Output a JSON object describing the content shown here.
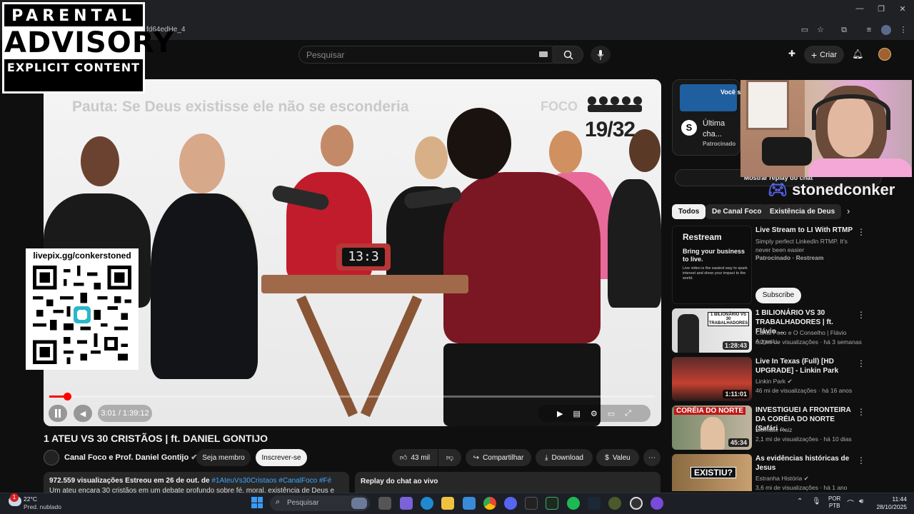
{
  "browser": {
    "url_fragment": "fd64edHe_4",
    "window_controls": [
      "—",
      "❐",
      "✕"
    ]
  },
  "youtube_header": {
    "search_placeholder": "Pesquisar",
    "create_label": "Criar"
  },
  "overlays": {
    "advisory": {
      "line1": "PARENTAL",
      "line2": "ADVISORY",
      "line3": "EXPLICIT CONTENT"
    },
    "donation_url": "livepix.gg/conkerstoned",
    "streamer_name": "stonedconker"
  },
  "video": {
    "banner_text": "Pauta: Se Deus existisse ele não se esconderia",
    "logo_text": "FOCO",
    "counter": "19/32",
    "clock_value": "13:3",
    "time_display": "3:01 / 1:39:12",
    "progress_fraction": 0.03
  },
  "video_info": {
    "title": "1 ATEU VS 30 CRISTÃOS | ft. DANIEL GONTIJO",
    "channel": "Canal Foco e Prof. Daniel Gontijo",
    "join_label": "Seja membro",
    "subscribe_label": "Inscrever-se",
    "likes": "43 mil",
    "share_label": "Compartilhar",
    "download_label": "Download",
    "thanks_label": "Valeu",
    "views_date": "972.559 visualizações  Estreou em 26 de out. de",
    "hashtags": "#1AteuVs30Cristaos #CanalFoco #Fé",
    "desc_snippet": "Um ateu encara 30 cristãos em um debate profundo sobre fé, moral, existência de Deus e se...",
    "replay_chat": "Replay do chat ao vivo"
  },
  "sidebar": {
    "sponsor_top": {
      "thumb_text": "Você s... quand...",
      "title": "Última cha... Smart por",
      "badge": "Patrocinado"
    },
    "show_replay_label": "Mostrar replay do chat",
    "chips": [
      "Todos",
      "De Canal Foco",
      "Existência de Deus"
    ],
    "recommendations": [
      {
        "title": "Live Stream to LI With RTMP",
        "meta1": "Simply perfect LinkedIn RTMP. It's never been easier",
        "meta2": "Patrocinado · Restream",
        "thumb_title": "Restream",
        "thumb_sub": "Bring your business to live.",
        "thumb_body": "Live video is the easiest way to spark interest and show your impact to the world.",
        "cta": "Subscribe"
      },
      {
        "title": "1 BILIONÁRIO VS 30 TRABALHADORES | ft. Flávio ...",
        "meta1": "Canal Foco e O Conselho | Flávio August...",
        "meta2": "6,2 mi de visualizações · há 3 semanas",
        "duration": "1:28:43",
        "thumb_text": "1 BILIONÁRIO VS 30 TRABALHADORES"
      },
      {
        "title": "Live In Texas (Full) [HD UPGRADE] - Linkin Park",
        "meta1": "Linkin Park",
        "meta2": "46 mi de visualizações · há 16 anos",
        "duration": "1:11:01"
      },
      {
        "title": "INVESTIGUEI A FRONTEIRA DA CORÉIA DO NORTE (Safári ...",
        "meta1": "Nômade Raiz",
        "meta2": "2,1 mi de visualizações · há 10 dias",
        "duration": "45:34",
        "thumb_text": "CORÉIA DO NORTE"
      },
      {
        "title": "As evidências históricas de Jesus",
        "meta1": "Estranha História",
        "meta2": "3,6 mi de visualizações · há 1 ano",
        "thumb_text": "EXISTIU?"
      }
    ]
  },
  "taskbar": {
    "weather_temp": "22°C",
    "weather_desc": "Pred. nublado",
    "weather_badge": "1",
    "search_placeholder": "Pesquisar",
    "lang1": "POR",
    "lang2": "PTB",
    "time": "11:44",
    "date": "28/10/2025"
  },
  "colors": {
    "accent": "#ff0000",
    "background": "#0f0f0f",
    "surface": "#272727"
  }
}
